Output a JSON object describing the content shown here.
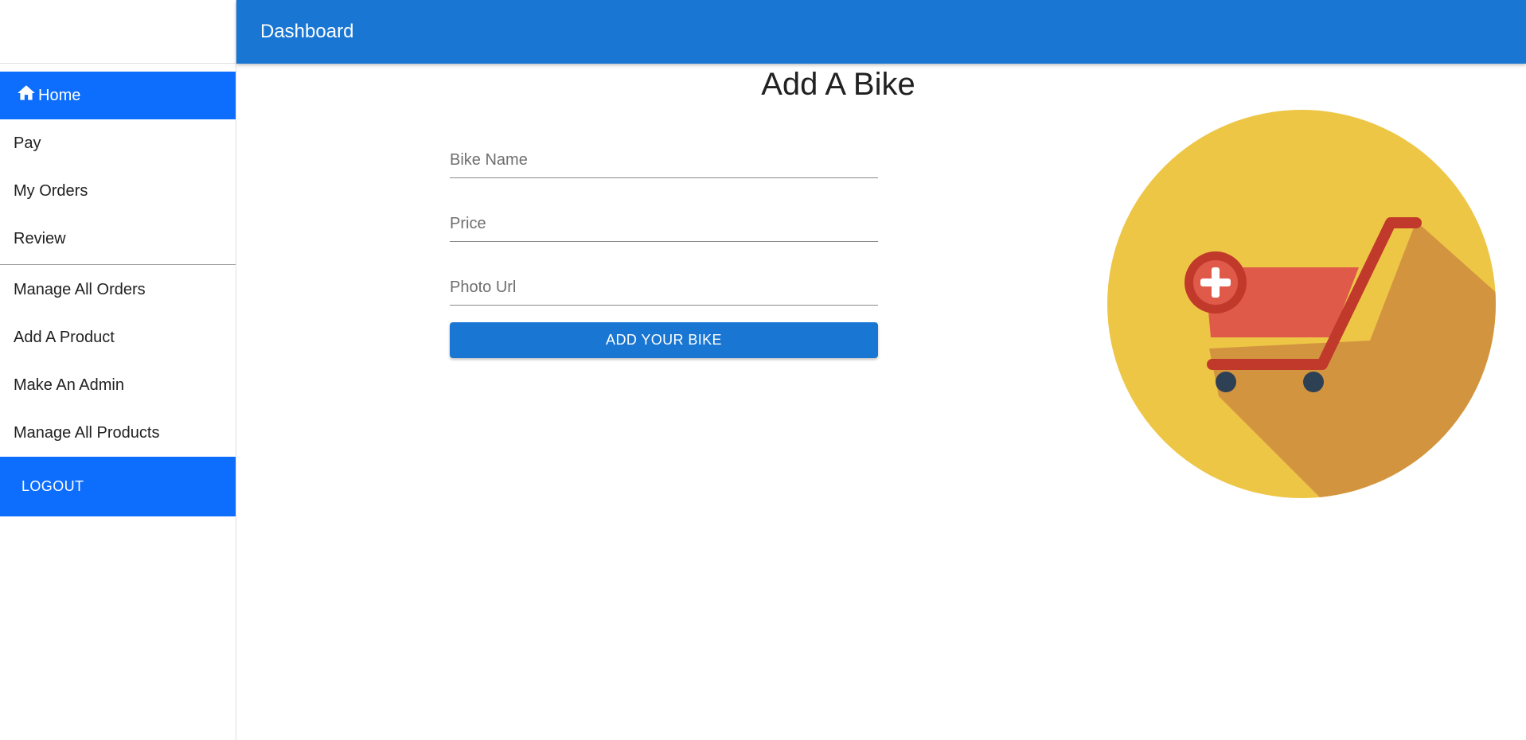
{
  "appbar": {
    "title": "Dashboard"
  },
  "sidebar": {
    "items": [
      {
        "label": "Home",
        "icon": "home-icon",
        "active": true
      },
      {
        "label": "Pay"
      },
      {
        "label": "My Orders"
      },
      {
        "label": "Review"
      }
    ],
    "admin_items": [
      {
        "label": "Manage All Orders"
      },
      {
        "label": "Add A Product"
      },
      {
        "label": "Make An Admin"
      },
      {
        "label": "Manage All Products"
      }
    ],
    "logout_label": "LOGOUT"
  },
  "main": {
    "title": "Add A Bike",
    "form": {
      "bike_name_placeholder": "Bike Name",
      "price_placeholder": "Price",
      "photo_url_placeholder": "Photo Url",
      "bike_name_value": "",
      "price_value": "",
      "photo_url_value": "",
      "submit_label": "ADD YOUR BIKE"
    },
    "illustration_icon": "add-to-cart-icon"
  },
  "colors": {
    "appbar": "#1976d2",
    "active_nav": "#0d6efd",
    "button": "#1976d2",
    "circle": "#eec646",
    "shadow": "#d39440",
    "cart": "#e05a4a",
    "cart_frame": "#c0392b",
    "wheels": "#2e4053"
  }
}
